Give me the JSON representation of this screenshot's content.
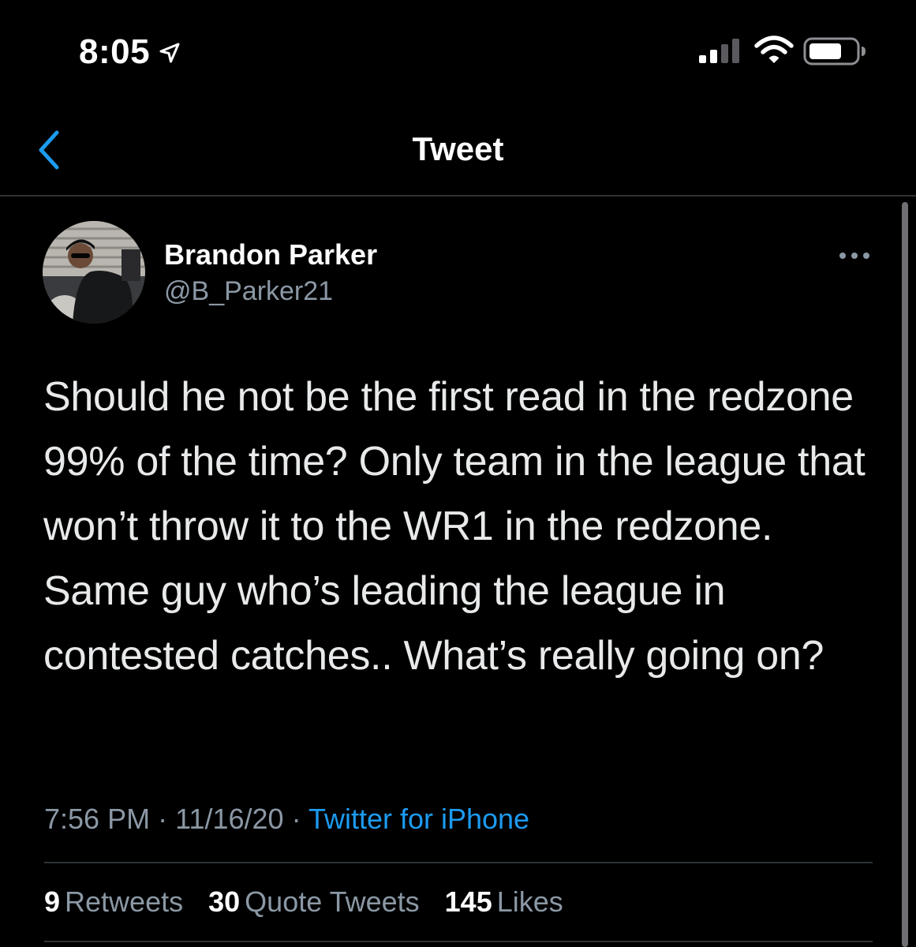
{
  "status_bar": {
    "time": "8:05",
    "icons": [
      "location-arrow-icon",
      "cellular-signal-icon",
      "wifi-icon",
      "battery-icon"
    ]
  },
  "header": {
    "title": "Tweet",
    "back_icon": "chevron-left-icon"
  },
  "tweet": {
    "author": {
      "name": "Brandon Parker",
      "handle": "@B_Parker21"
    },
    "more_icon": "ellipsis-icon",
    "text": "Should he not be the first read in the redzone 99% of the time? Only team in the league that won’t throw it to the WR1 in the redzone. Same guy who’s leading the league in contested catches.. What’s really going on?",
    "time": "7:56 PM",
    "date": "11/16/20",
    "separator": "·",
    "source": "Twitter for iPhone"
  },
  "stats": {
    "retweets_count": "9",
    "retweets_label": "Retweets",
    "quotes_count": "30",
    "quotes_label": "Quote Tweets",
    "likes_count": "145",
    "likes_label": "Likes"
  },
  "colors": {
    "background": "#000000",
    "text": "#e7e9ea",
    "secondary": "#8b98a5",
    "link": "#1d9bf0",
    "divider": "#2f3336"
  }
}
